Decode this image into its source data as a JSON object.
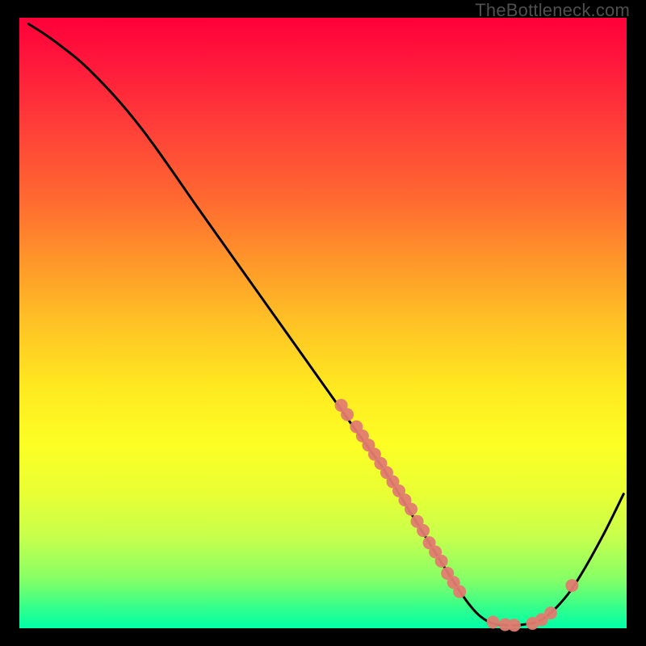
{
  "watermark": "TheBottleneck.com",
  "chart_data": {
    "type": "line",
    "title": "",
    "xlabel": "",
    "ylabel": "",
    "xlim": [
      0,
      100
    ],
    "ylim": [
      0,
      100
    ],
    "curve": [
      {
        "x": 1.5,
        "y": 99
      },
      {
        "x": 6,
        "y": 96
      },
      {
        "x": 12,
        "y": 91
      },
      {
        "x": 20,
        "y": 82
      },
      {
        "x": 30,
        "y": 68
      },
      {
        "x": 40,
        "y": 54
      },
      {
        "x": 50,
        "y": 40
      },
      {
        "x": 55,
        "y": 33
      },
      {
        "x": 60,
        "y": 26
      },
      {
        "x": 65,
        "y": 18
      },
      {
        "x": 70,
        "y": 10
      },
      {
        "x": 74,
        "y": 4
      },
      {
        "x": 77,
        "y": 1.2
      },
      {
        "x": 80,
        "y": 0.5
      },
      {
        "x": 83,
        "y": 0.6
      },
      {
        "x": 86,
        "y": 1.4
      },
      {
        "x": 89,
        "y": 4
      },
      {
        "x": 92,
        "y": 8
      },
      {
        "x": 96,
        "y": 15
      },
      {
        "x": 99.5,
        "y": 22
      }
    ],
    "points": [
      {
        "x": 53,
        "y": 36.5
      },
      {
        "x": 54,
        "y": 35
      },
      {
        "x": 55.5,
        "y": 33
      },
      {
        "x": 56.5,
        "y": 31.5
      },
      {
        "x": 57.5,
        "y": 30
      },
      {
        "x": 58.5,
        "y": 28.5
      },
      {
        "x": 59.5,
        "y": 27
      },
      {
        "x": 60.5,
        "y": 25.5
      },
      {
        "x": 61.5,
        "y": 24
      },
      {
        "x": 62.5,
        "y": 22.5
      },
      {
        "x": 63.5,
        "y": 21
      },
      {
        "x": 64.5,
        "y": 19.5
      },
      {
        "x": 65.5,
        "y": 17.5
      },
      {
        "x": 66.5,
        "y": 16
      },
      {
        "x": 67.5,
        "y": 14
      },
      {
        "x": 68.5,
        "y": 12.5
      },
      {
        "x": 69.5,
        "y": 11
      },
      {
        "x": 70.5,
        "y": 9
      },
      {
        "x": 71.5,
        "y": 7.5
      },
      {
        "x": 72.5,
        "y": 6
      },
      {
        "x": 78,
        "y": 1
      },
      {
        "x": 80,
        "y": 0.6
      },
      {
        "x": 81.5,
        "y": 0.5
      },
      {
        "x": 84.5,
        "y": 0.8
      },
      {
        "x": 86,
        "y": 1.4
      },
      {
        "x": 87.5,
        "y": 2.5
      },
      {
        "x": 91,
        "y": 7
      }
    ],
    "point_color": "#e17c70",
    "curve_color": "#000000"
  }
}
